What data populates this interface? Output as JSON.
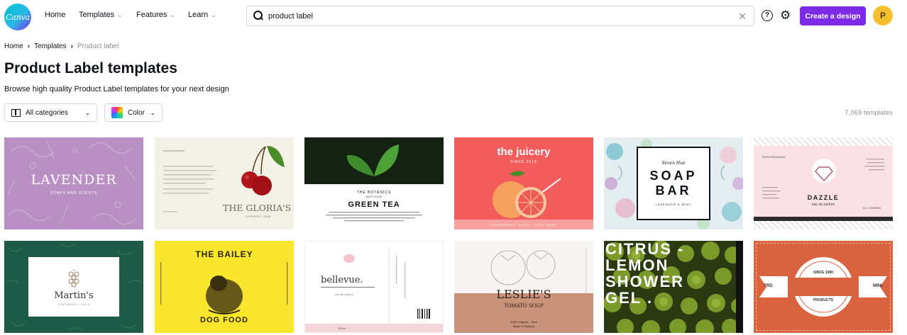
{
  "nav": {
    "logo": "Canva",
    "home": "Home",
    "templates": "Templates",
    "features": "Features",
    "learn": "Learn"
  },
  "search": {
    "value": "product label"
  },
  "create_label": "Create a design",
  "avatar_initial": "P",
  "breadcrumb": {
    "home": "Home",
    "templates": "Templates",
    "current": "Product label"
  },
  "title": "Product Label templates",
  "subtitle": "Browse high quality Product Label templates for your next design",
  "filters": {
    "categories": "All categories",
    "color": "Color"
  },
  "template_count": "7,069 templates",
  "templates": [
    {
      "title": "LAVENDER",
      "sub": "SOAPS AND SCENTS"
    },
    {
      "title": "THE GLORIA'S",
      "sub": "CHERRY JAM"
    },
    {
      "brand": "THE BOTANICS",
      "kind": "BATH SOAP",
      "title": "GREEN TEA"
    },
    {
      "title": "the juicery",
      "sub": "SINCE 2016",
      "footer": "GRAPEFRUIT JUICE · 100% PURE"
    },
    {
      "brand": "Seven Hue",
      "title": "SOAP",
      "title2": "BAR",
      "sub": "LAVENDER & MINT"
    },
    {
      "title": "DAZZLE",
      "sub": "eau de parfum",
      "left": "ROSE FRAGRANCE",
      "right": "D.C. COMPANY"
    },
    {
      "title": "Martin's",
      "sub": "ZINFANDEL 2014"
    },
    {
      "title": "THE BAILEY",
      "sub": "DOG FOOD"
    },
    {
      "title": "bellevue.",
      "sub": "eau de parfum",
      "footer": "100ml"
    },
    {
      "title": "LESLIE'S",
      "sub": "TOMATO SOUP",
      "footer": "100% Organic · 15oz",
      "footer2": "Made in England"
    },
    {
      "title": "CITRUS -",
      "title2": "LEMON",
      "title3": "SHOWER",
      "title4": "GEL ."
    },
    {
      "top": "SINCE 1980",
      "left": "TRD.",
      "right": "MRK",
      "sub": "PRODUCTS"
    }
  ],
  "colors": {
    "accent": "#7d2ae8",
    "avatar": "#f5c02e",
    "logo": "#00c4cc"
  }
}
